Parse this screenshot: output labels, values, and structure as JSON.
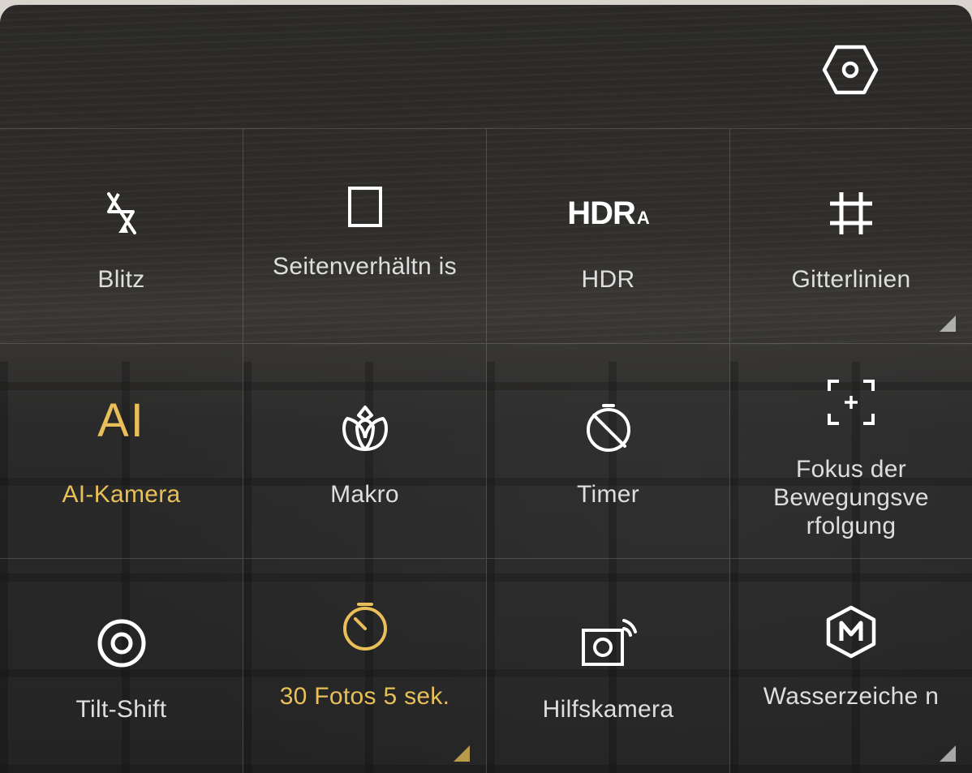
{
  "settings": {
    "icon": "hexagon-gear-icon"
  },
  "colors": {
    "active": "#e8bf58",
    "text": "#dedede",
    "icon": "#ffffff"
  },
  "tiles": [
    {
      "label": "Blitz",
      "icon": "flash-off-icon",
      "active": false
    },
    {
      "label": "Seitenverhältn is",
      "icon": "aspect-ratio-icon",
      "active": false
    },
    {
      "label": "HDR",
      "icon": "hdr-auto-icon",
      "icon_text": "HDR",
      "icon_sub": "A",
      "active": false
    },
    {
      "label": "Gitterlinien",
      "icon": "grid-lines-icon",
      "active": false,
      "has_submenu": true
    },
    {
      "label": "AI-Kamera",
      "icon": "ai-icon",
      "icon_text": "AI",
      "active": true
    },
    {
      "label": "Makro",
      "icon": "macro-flower-icon",
      "active": false
    },
    {
      "label": "Timer",
      "icon": "timer-off-icon",
      "active": false
    },
    {
      "label": "Fokus der Bewegungsve rfolgung",
      "icon": "motion-focus-icon",
      "active": false
    },
    {
      "label": "Tilt-Shift",
      "icon": "tilt-shift-icon",
      "active": false
    },
    {
      "label": "30 Fotos 5 sek.",
      "icon": "burst-timer-icon",
      "active": true,
      "has_submenu": true
    },
    {
      "label": "Hilfskamera",
      "icon": "assist-camera-icon",
      "active": false
    },
    {
      "label": "Wasserzeiche n",
      "icon": "watermark-icon",
      "active": false,
      "has_submenu": true
    }
  ]
}
